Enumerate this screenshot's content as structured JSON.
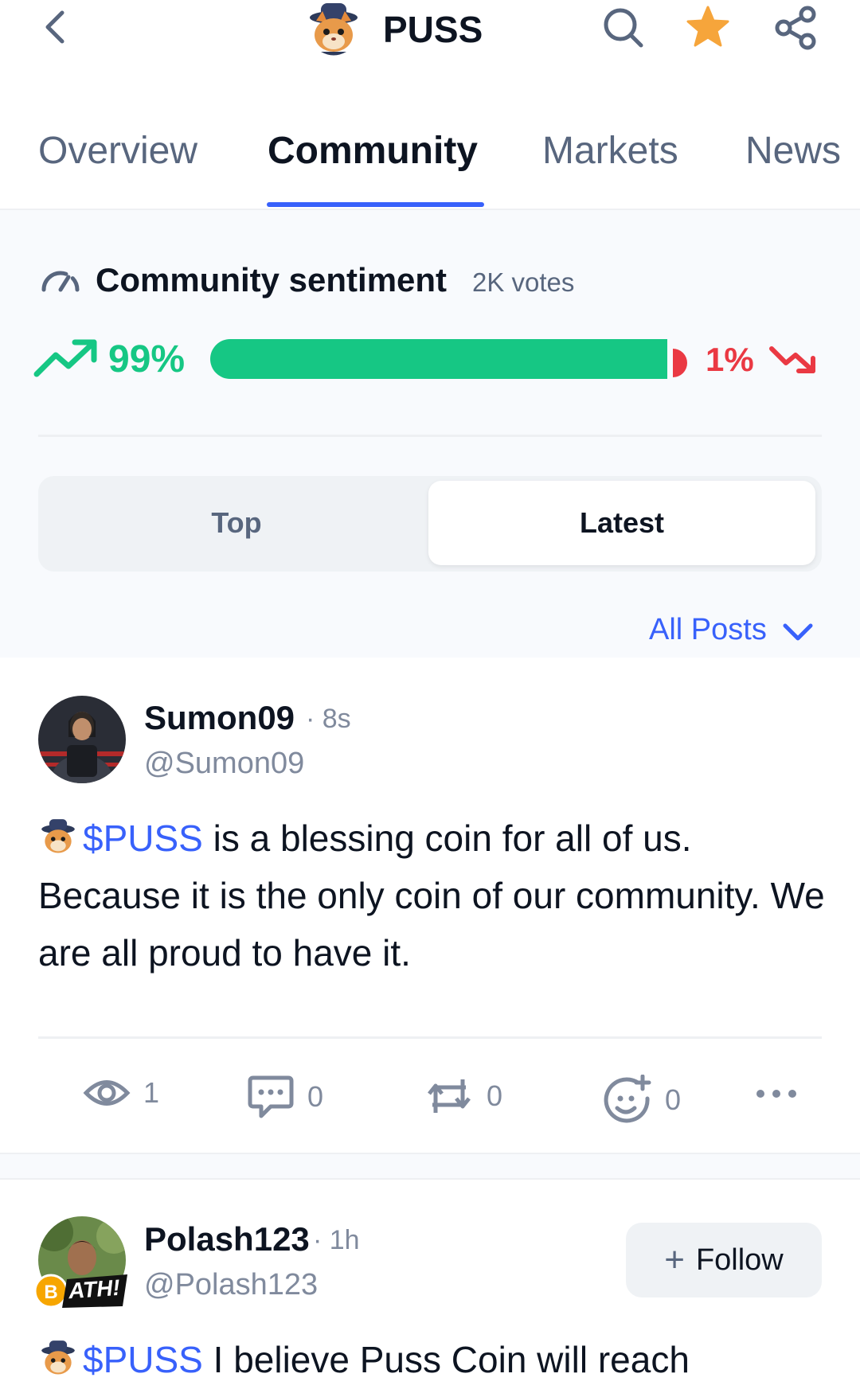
{
  "header": {
    "title": "PUSS",
    "icons": [
      "back-chevron-icon",
      "puss-logo-icon",
      "search-icon",
      "star-icon",
      "share-icon"
    ],
    "star_color": "#f6a53b"
  },
  "tabs": [
    {
      "label": "Overview",
      "active": false
    },
    {
      "label": "Community",
      "active": true
    },
    {
      "label": "Markets",
      "active": false
    },
    {
      "label": "News",
      "active": false
    }
  ],
  "sentiment": {
    "title": "Community sentiment",
    "votes": "2K votes",
    "bullish_pct": "99%",
    "bearish_pct": "1%",
    "bullish_fraction": 0.99,
    "bullish_color": "#16c784",
    "bearish_color": "#ea3943"
  },
  "sort": {
    "options": [
      "Top",
      "Latest"
    ],
    "selected": "Latest"
  },
  "filter": {
    "label": "All Posts"
  },
  "posts": [
    {
      "username": "Sumon09",
      "time": "· 8s",
      "handle": "@Sumon09",
      "ticker": "$PUSS",
      "text_line1": " is a blessing coin for all of us.",
      "text_rest": "Because it is the only coin of our community. We are all proud to have it.",
      "views": "1",
      "comments": "0",
      "reposts": "0",
      "reactions": "0"
    },
    {
      "username": "Polash123",
      "time": "· 1h",
      "handle": "@Polash123",
      "badge": "ATH!",
      "follow_label": "Follow",
      "ticker": "$PUSS",
      "text_line1": " I believe Puss Coin will reach"
    }
  ],
  "accent_color": "#3861fb"
}
